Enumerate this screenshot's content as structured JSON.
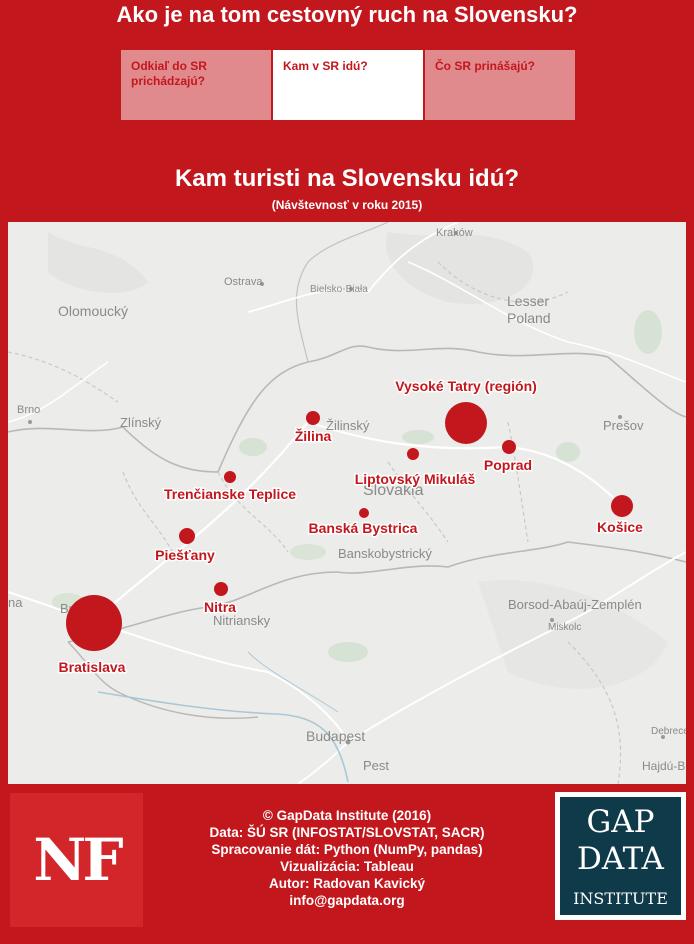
{
  "header": {
    "title": "Ako je na tom cestovný ruch na Slovensku?",
    "tabs": [
      {
        "label": "Odkiaľ do SR prichádzajú?",
        "active": false
      },
      {
        "label": "Kam v SR idú?",
        "active": true
      },
      {
        "label": "Čo SR prinášajú?",
        "active": false
      }
    ]
  },
  "section": {
    "title": "Kam turisti na Slovensku idú?",
    "subtitle": "(Návštevnosť v roku 2015)"
  },
  "map": {
    "base_labels": {
      "krakow": "Kraków",
      "ostrava": "Ostrava",
      "bielsko": "Bielsko-Biała",
      "olomoucky": "Olomoucký",
      "lesser": "Lesser",
      "poland": "Poland",
      "brno": "Brno",
      "zlinsky": "Zlínský",
      "zilinsky": "Žilinský",
      "presov": "Prešov",
      "slovakia": "Slovakia",
      "banskobystricky": "Banskobystrický",
      "nitriansky": "Nitriansky",
      "bratislava_base": "Bratislava",
      "borsod": "Borsod-Abaúj-Zemplén",
      "miskolc": "Miskolc",
      "budapest": "Budapest",
      "pest": "Pest",
      "debrecen": "Debrece",
      "hajdu": "Hajdú-Bih",
      "edge_na": "na"
    },
    "marker_color": "#c3171e",
    "locations": [
      {
        "name": "Bratislava",
        "size": "largest"
      },
      {
        "name": "Vysoké Tatry (región)",
        "size": "large"
      },
      {
        "name": "Košice",
        "size": "medium"
      },
      {
        "name": "Piešťany",
        "size": "small"
      },
      {
        "name": "Žilina",
        "size": "small"
      },
      {
        "name": "Poprad",
        "size": "small"
      },
      {
        "name": "Nitra",
        "size": "small"
      },
      {
        "name": "Trenčianske Teplice",
        "size": "small"
      },
      {
        "name": "Liptovský Mikuláš",
        "size": "small"
      },
      {
        "name": "Banská Bystrica",
        "size": "smallest"
      }
    ]
  },
  "footer": {
    "nf_logo": "NF",
    "credits": [
      "© GapData Institute (2016)",
      "Data: ŠÚ SR (INFOSTAT/SLOVSTAT, SACR)",
      "Spracovanie dát: Python (NumPy, pandas)",
      "Vizualizácia: Tableau",
      "Autor: Radovan Kavický",
      "info@gapdata.org"
    ],
    "gap_logo": {
      "line1": "GAP",
      "line2": "DATA",
      "line3": "INSTITUTE"
    }
  }
}
